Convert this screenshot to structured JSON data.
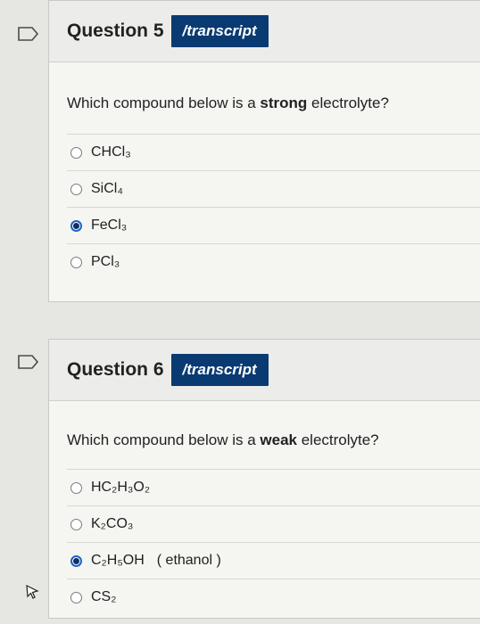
{
  "questions": [
    {
      "title": "Question 5",
      "transcript_label": "/transcript",
      "prompt_before": "Which compound below is a ",
      "prompt_bold": "strong",
      "prompt_after": " electrolyte?",
      "options": [
        {
          "text": "CHCl₃",
          "selected": false
        },
        {
          "text": "SiCl₄",
          "selected": false
        },
        {
          "text": "FeCl₃",
          "selected": true
        },
        {
          "text": "PCl₃",
          "selected": false
        }
      ]
    },
    {
      "title": "Question 6",
      "transcript_label": "/transcript",
      "prompt_before": "Which compound below is a ",
      "prompt_bold": "weak",
      "prompt_after": " electrolyte?",
      "options": [
        {
          "text": "HC₂H₃O₂",
          "selected": false
        },
        {
          "text": "K₂CO₃",
          "selected": false
        },
        {
          "text": "C₂H₅OH",
          "note": "( ethanol )",
          "selected": true
        },
        {
          "text": "CS₂",
          "selected": false
        }
      ]
    }
  ]
}
